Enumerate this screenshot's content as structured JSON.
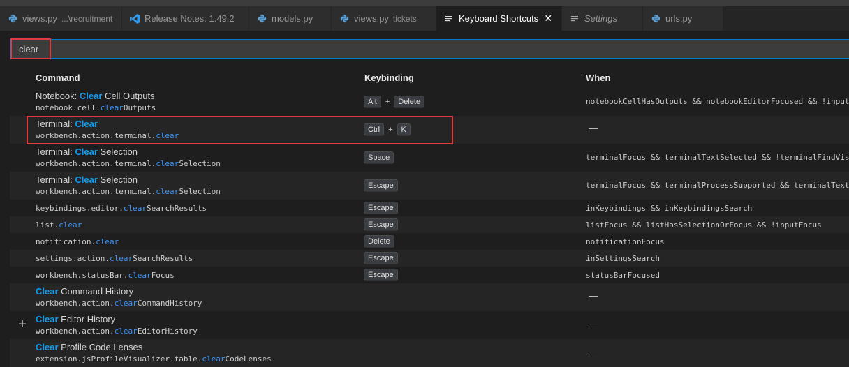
{
  "tabs": [
    {
      "label": "views.py",
      "desc": "...\\recruitment",
      "icon": "python-icon",
      "width": 175
    },
    {
      "label": "Release Notes: 1.49.2",
      "desc": "",
      "icon": "vscode-icon",
      "width": 182
    },
    {
      "label": "models.py",
      "desc": "",
      "icon": "python-icon",
      "width": 118
    },
    {
      "label": "views.py",
      "desc": "tickets",
      "icon": "python-icon",
      "width": 150
    },
    {
      "label": "Keyboard Shortcuts",
      "desc": "",
      "icon": "keyboard-shortcuts-icon",
      "width": 180,
      "active": true,
      "close": "✕"
    },
    {
      "label": "Settings",
      "desc": "",
      "icon": "settings-list-icon",
      "width": 116,
      "italic": true
    },
    {
      "label": "urls.py",
      "desc": "",
      "icon": "python-icon",
      "width": 115
    }
  ],
  "search": {
    "value": "clear"
  },
  "headers": {
    "command": "Command",
    "keybinding": "Keybinding",
    "when": "When"
  },
  "rows": [
    {
      "title": [
        [
          "Notebook: ",
          ""
        ],
        [
          "Clear",
          "h"
        ],
        [
          " Cell Outputs",
          ""
        ]
      ],
      "id": [
        [
          "notebook.cell.",
          ""
        ],
        [
          "clear",
          "h"
        ],
        [
          "Outputs",
          ""
        ]
      ],
      "keys": [
        "Alt",
        "Delete"
      ],
      "when": "notebookCellHasOutputs && notebookEditorFocused && !inputFocus"
    },
    {
      "title": [
        [
          "Terminal: ",
          ""
        ],
        [
          "Clear",
          "h"
        ]
      ],
      "id": [
        [
          "workbench.action.terminal.",
          ""
        ],
        [
          "clear",
          "h"
        ]
      ],
      "keys": [
        "Ctrl",
        "K"
      ],
      "when": "—"
    },
    {
      "title": [
        [
          "Terminal: ",
          ""
        ],
        [
          "Clear",
          "h"
        ],
        [
          " Selection",
          ""
        ]
      ],
      "id": [
        [
          "workbench.action.terminal.",
          ""
        ],
        [
          "clear",
          "h"
        ],
        [
          "Selection",
          ""
        ]
      ],
      "keys": [
        "Space"
      ],
      "when": "terminalFocus && terminalTextSelected && !terminalFindVisible"
    },
    {
      "title": [
        [
          "Terminal: ",
          ""
        ],
        [
          "Clear",
          "h"
        ],
        [
          " Selection",
          ""
        ]
      ],
      "id": [
        [
          "workbench.action.terminal.",
          ""
        ],
        [
          "clear",
          "h"
        ],
        [
          "Selection",
          ""
        ]
      ],
      "keys": [
        "Escape"
      ],
      "when": "terminalFocus && terminalProcessSupported && terminalTextSelected"
    },
    {
      "title": null,
      "id": [
        [
          "keybindings.editor.",
          ""
        ],
        [
          "clear",
          "h"
        ],
        [
          "SearchResults",
          ""
        ]
      ],
      "keys": [
        "Escape"
      ],
      "when": "inKeybindings && inKeybindingsSearch"
    },
    {
      "title": null,
      "id": [
        [
          "list.",
          ""
        ],
        [
          "clear",
          "h"
        ]
      ],
      "keys": [
        "Escape"
      ],
      "when": "listFocus && listHasSelectionOrFocus && !inputFocus"
    },
    {
      "title": null,
      "id": [
        [
          "notification.",
          ""
        ],
        [
          "clear",
          "h"
        ]
      ],
      "keys": [
        "Delete"
      ],
      "when": "notificationFocus"
    },
    {
      "title": null,
      "id": [
        [
          "settings.action.",
          ""
        ],
        [
          "clear",
          "h"
        ],
        [
          "SearchResults",
          ""
        ]
      ],
      "keys": [
        "Escape"
      ],
      "when": "inSettingsSearch"
    },
    {
      "title": null,
      "id": [
        [
          "workbench.statusBar.",
          ""
        ],
        [
          "clear",
          "h"
        ],
        [
          "Focus",
          ""
        ]
      ],
      "keys": [
        "Escape"
      ],
      "when": "statusBarFocused"
    },
    {
      "title": [
        [
          "Clear",
          "h"
        ],
        [
          " Command History",
          ""
        ]
      ],
      "id": [
        [
          "workbench.action.",
          ""
        ],
        [
          "clear",
          "h"
        ],
        [
          "CommandHistory",
          ""
        ]
      ],
      "keys": [],
      "when": "—"
    },
    {
      "title": [
        [
          "Clear",
          "h"
        ],
        [
          " Editor History",
          ""
        ]
      ],
      "id": [
        [
          "workbench.action.",
          ""
        ],
        [
          "clear",
          "h"
        ],
        [
          "EditorHistory",
          ""
        ]
      ],
      "keys": [],
      "when": "—"
    },
    {
      "title": [
        [
          "Clear",
          "h"
        ],
        [
          " Profile Code Lenses",
          ""
        ]
      ],
      "id": [
        [
          "extension.jsProfileVisualizer.table.",
          ""
        ],
        [
          "clear",
          "h"
        ],
        [
          "CodeLenses",
          ""
        ]
      ],
      "keys": [],
      "when": "—"
    }
  ],
  "keySeparator": "+",
  "addButton": "+",
  "colors": {
    "accent": "#007acc",
    "highlight": "#3794ff",
    "annotation": "#e0393e"
  }
}
